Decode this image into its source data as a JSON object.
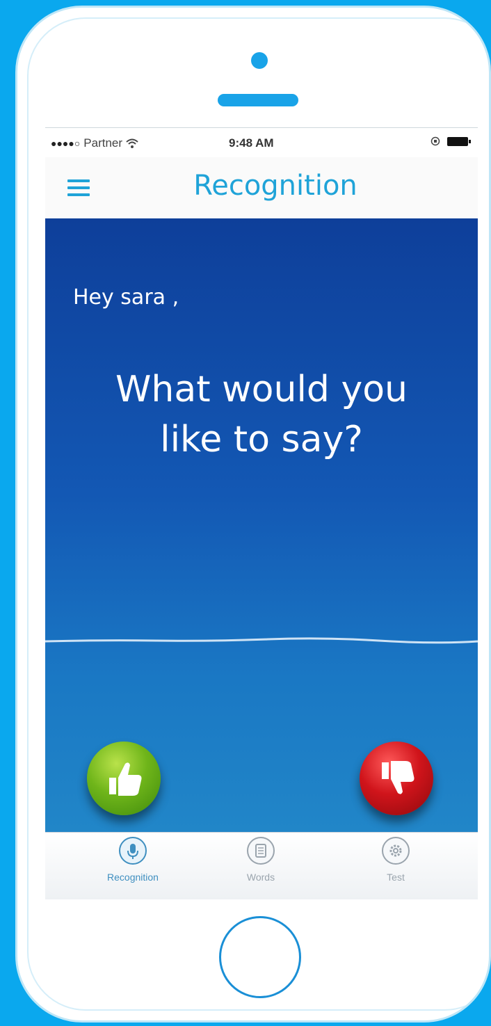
{
  "status_bar": {
    "signal": "●●●●○",
    "carrier": "Partner",
    "wifi_icon": "wifi-icon",
    "time": "9:48 AM",
    "lock_icon": "rotation-lock-icon",
    "battery_icon": "battery-icon"
  },
  "nav": {
    "title": "Recognition",
    "menu_icon": "hamburger-menu-icon",
    "accent": "#1fa3d8"
  },
  "main": {
    "greeting": "Hey sara ,",
    "prompt_line1": "What would you",
    "prompt_line2": "like to say?",
    "thumbs_up_icon": "thumbs-up-icon",
    "thumbs_down_icon": "thumbs-down-icon",
    "up_color": "#6fb51a",
    "down_color": "#d0141b"
  },
  "tabs": [
    {
      "label": "Recognition",
      "icon": "microphone-icon",
      "active": true
    },
    {
      "label": "Words",
      "icon": "document-icon",
      "active": false
    },
    {
      "label": "Test",
      "icon": "gear-icon",
      "active": false
    }
  ],
  "background_color": "#0aa8ee"
}
